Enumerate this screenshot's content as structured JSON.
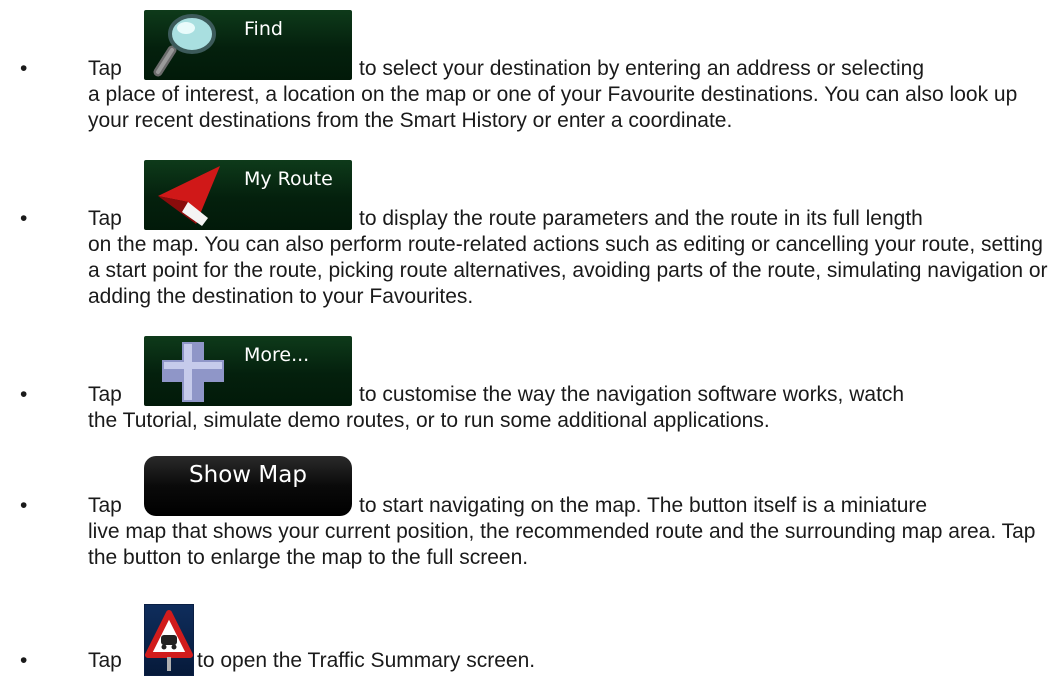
{
  "items": [
    {
      "bullet": "•",
      "tap": "Tap",
      "button_label": "Find",
      "icon": "magnifier-icon",
      "line1": "to select your destination by entering an address or selecting",
      "rest": "a place of interest, a location on the map or one of your Favourite destinations. You can also look up your recent destinations from the Smart History or enter a coordinate."
    },
    {
      "bullet": "•",
      "tap": "Tap",
      "button_label": "My Route",
      "icon": "route-arrow-icon",
      "line1": "to display the route parameters and the route in its full length",
      "rest": "on the map. You can also perform route-related actions such as editing or cancelling your route, setting a start point for the route, picking route alternatives, avoiding parts of the route, simulating navigation or adding the destination to your Favourites."
    },
    {
      "bullet": "•",
      "tap": "Tap",
      "button_label": "More...",
      "icon": "plus-icon",
      "line1": "to customise the way the navigation software works, watch",
      "rest": "the Tutorial, simulate demo routes, or to run some additional applications."
    },
    {
      "bullet": "•",
      "tap": "Tap",
      "button_label": "Show Map",
      "line1": "to start navigating on the map. The button itself is a miniature",
      "rest": "live map that shows your current position, the recommended route and the surrounding map area. Tap the button to enlarge the map to the full screen."
    },
    {
      "bullet": "•",
      "tap": "Tap",
      "icon": "traffic-warning-icon",
      "line1": "to open the Traffic Summary screen."
    }
  ]
}
